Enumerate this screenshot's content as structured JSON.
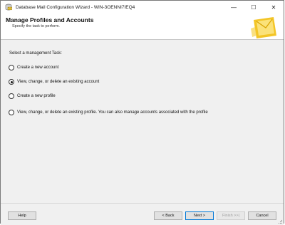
{
  "window": {
    "title": "Database Mail Configuration Wizard - WIN-3OENNI7IEQ4",
    "controls": [
      "—",
      "☐",
      "✕"
    ]
  },
  "header": {
    "title": "Manage Profiles and Accounts",
    "subtitle": "Specify the task to perform."
  },
  "main": {
    "prompt": "Select a management Task:",
    "options": [
      {
        "label": "Create a new account",
        "checked": false
      },
      {
        "label": "View, change, or delete an existing account",
        "checked": true
      },
      {
        "label": "Create a new profile",
        "checked": false
      },
      {
        "label": "View, change, or delete an existing profile. You can also manage accounts associated with the profile",
        "checked": false
      }
    ]
  },
  "footer": {
    "help": "Help",
    "back": "< Back",
    "next": "Next >",
    "finish": "Finish >>|",
    "cancel": "Cancel"
  },
  "icons": {
    "app": "database-mail-icon",
    "logo": "envelope-logo-icon"
  },
  "colors": {
    "accent": "#0078d7",
    "logo_yellow": "#f2c21a"
  }
}
